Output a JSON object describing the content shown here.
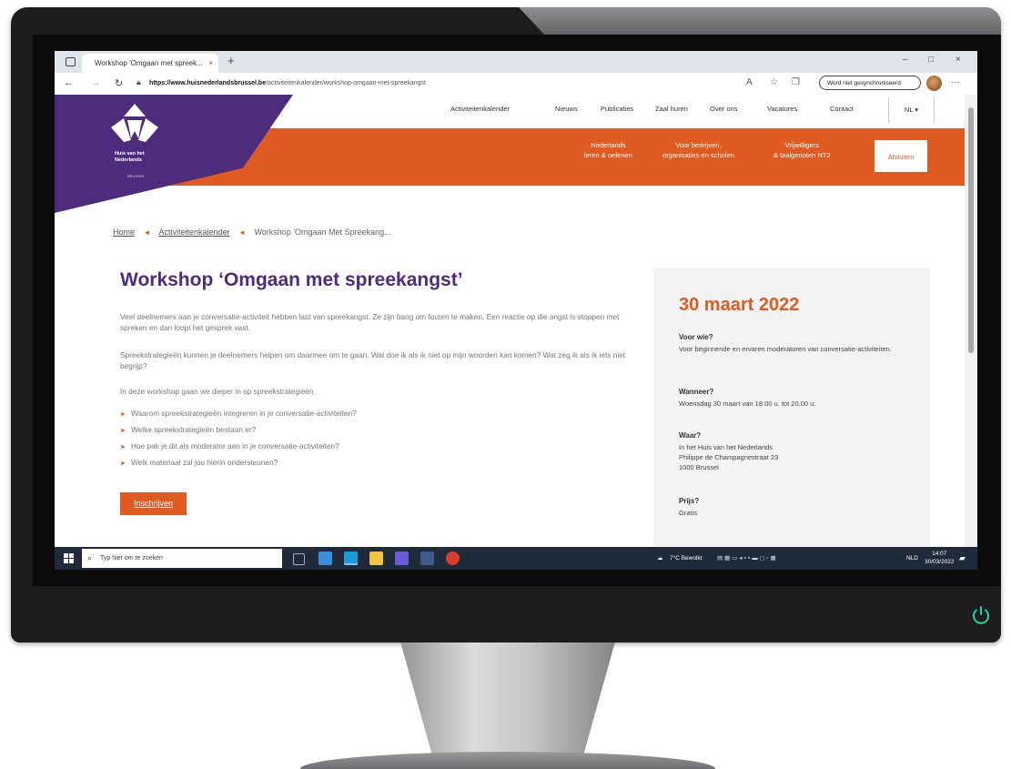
{
  "browser": {
    "tab_title": "Workshop 'Omgaan met spreek...",
    "tab_close": "×",
    "new_tab": "+",
    "window_minimize": "–",
    "window_maximize": "□",
    "window_close": "×",
    "url_host": "https://www.huisnederlandsbrussel.be",
    "url_path": "/activiteitenkalender/workshop-omgaan-met-spreekangst",
    "signin_label": "Word niet gesynchroniseerd"
  },
  "site": {
    "logo_text": "Huis van het Nederlands",
    "logo_sub": "BRUSSEL",
    "top_nav": [
      "Activiteitenkalender",
      "Nieuws",
      "Publicaties",
      "Zaal huren",
      "Over ons",
      "Vacatures",
      "Contact"
    ],
    "lang": "NL ▾",
    "orange_nav": [
      {
        "line1": "Nederlands",
        "line2": "leren & oefenen"
      },
      {
        "line1": "Voor bedrijven,",
        "line2": "organisaties en scholen"
      },
      {
        "line1": "Vrijwilligers",
        "line2": "& taalgenoten NT2"
      }
    ],
    "cta": "Afsluiten",
    "breadcrumb": [
      "Home",
      "Activiteitenkalender",
      "Workshop 'Omgaan Met Spreekang..."
    ],
    "breadcrumb_sep": "◄",
    "title": "Workshop ‘Omgaan met spreekangst’",
    "paragraphs": [
      "Veel deelnemers aan je conversatie-activiteit hebben last van spreekangst. Ze zijn bang om fouten te maken. Een reactie op die angst is stoppen met spreken en dan loopt het gesprek vast.",
      "Spreekstrategieën kunnen je deelnemers helpen om daarmee om te gaan. Wat doe ik als ik niet op mijn woorden kan komen? Wat zeg ik als ik iets niet begrijp?",
      "In deze workshop gaan we dieper in op spreekstrategieën."
    ],
    "bullet_marker": "►",
    "bullets": [
      "Waarom spreekstrategieën integreren in je conversatie-activiteiten?",
      "Welke spreekstrategieën bestaan er?",
      "Hoe pak je dit als moderator aan in je conversatie-activiteiten?",
      "Welk materiaal zal jou hierin ondersteunen?"
    ],
    "register_button": "Inschrijven",
    "sidebar": {
      "date": "30 maart 2022",
      "who_label": "Voor wie?",
      "who_value": "Voor beginnende en ervaren moderatoren van conversatie-activiteiten.",
      "when_label": "Wanneer?",
      "when_value": "Woensdag 30 maart van 18.00 u. tot 20.00 u.",
      "where_label": "Waar?",
      "where_value_1": "In het Huis van het Nederlands",
      "where_value_2": "Philippe de Champagnestraat 23",
      "where_value_3": "1000 Brussel",
      "price_label": "Prijs?",
      "price_value": "Gratis"
    }
  },
  "taskbar": {
    "search_placeholder": "Typ hier om te zoeken",
    "weather": "7°C  Bewolkt",
    "lang": "NLD",
    "time": "14:07",
    "date": "30/03/2022"
  },
  "colors": {
    "accent_orange": "#e05b22",
    "brand_purple": "#4d2c7e",
    "taskbar": "#1f2a3a"
  }
}
